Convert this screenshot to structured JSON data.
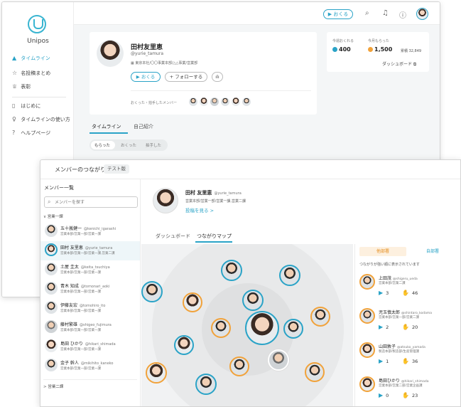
{
  "colors": {
    "accent": "#2aa3c7",
    "orange": "#f1a23a"
  },
  "back": {
    "brand": "Unipos",
    "nav": [
      {
        "icon": "home-icon",
        "glyph": "▲",
        "label": "タイムライン"
      },
      {
        "icon": "star-icon",
        "glyph": "☆",
        "label": "名投稿まとめ"
      },
      {
        "icon": "trophy-icon",
        "glyph": "♕",
        "label": "表彰"
      },
      {
        "icon": "doc-icon",
        "glyph": "▯",
        "label": "はじめに"
      },
      {
        "icon": "bulb-icon",
        "glyph": "♀",
        "label": "タイムラインの使い方"
      },
      {
        "icon": "help-icon",
        "glyph": "?",
        "label": "ヘルプページ"
      }
    ],
    "topbar": {
      "send_label": "▶ おくる"
    },
    "profile": {
      "name": "田村友里恵",
      "handle": "@yurie_tamura",
      "dept": "東京本社/〇〇事業本部/△△事業/営業部",
      "send_btn": "▶ おくる",
      "follow_btn": "+ フォローする",
      "sent_members_label": "おくった・拍手したメンバー"
    },
    "stats": {
      "sent_label": "今週おくれる",
      "sent_value": "400",
      "received_label": "今月もらった",
      "received_value": "1,500",
      "total_label": "累積 32,849",
      "dashboard_label": "ダッシュボード ⧉"
    },
    "tabs": [
      "タイムライン",
      "自己紹介"
    ],
    "segments": [
      "もらった",
      "おくった",
      "拍手した"
    ]
  },
  "front": {
    "title": "メンバーのつながり",
    "badge": "テスト版",
    "members_title": "メンバー一覧",
    "search_placeholder": "メンバーを探す",
    "group1": "∨ 営業一課",
    "group2": "> 営業二課",
    "members": [
      {
        "name": "五十嵐健一",
        "handle": "@kenichi_igarashi",
        "dept": "営業本部/営業一部/営業一課"
      },
      {
        "name": "田村 友里恵",
        "handle": "@yurie_tamura",
        "dept": "営業本部/営業一部/営業一課,営業二課"
      },
      {
        "name": "土屋 圭太",
        "handle": "@keita_tsuchiya",
        "dept": "営業本部/営業一部/営業一課"
      },
      {
        "name": "青木 知成",
        "handle": "@tomonari_aoki",
        "dept": "営業本部/営業一部/営業一課"
      },
      {
        "name": "伊藤友宏",
        "handle": "@tomohiro_ito",
        "dept": "営業本部/営業一部/営業一課"
      },
      {
        "name": "藤村繁雄",
        "handle": "@shigeo_fujimura",
        "dept": "営業本部/営業一部/営業一課"
      },
      {
        "name": "島田 ひかり",
        "handle": "@hikari_shimada",
        "dept": "営業本部/営業一部/営業一課"
      },
      {
        "name": "金子 幹人",
        "handle": "@mikihito_kaneko",
        "dept": "営業本部/営業一部/営業一課"
      }
    ],
    "user": {
      "name": "田村 友里恵",
      "handle": "@yurie_tamura",
      "dept": "営業本部/営業一部/営業一課,営業二課",
      "posts_link": "投稿を見る >"
    },
    "tabs": [
      "ダッシュボード",
      "つながりマップ"
    ],
    "panel": {
      "tab_other": "他部署",
      "tab_own": "自部署",
      "note": "つながりが強い順に表示されています",
      "items": [
        {
          "name": "上田茂",
          "handle": "@shigeru_ueda",
          "dept": "営業本部/営業二課",
          "sent": "3",
          "received": "46"
        },
        {
          "name": "児玉慎太郎",
          "handle": "@shintaro_kodama",
          "dept": "営業本部/営業一部/営業二課",
          "sent": "2",
          "received": "20"
        },
        {
          "name": "山田敦子",
          "handle": "@atsuko_yamada",
          "dept": "製造本部/製造部/生産管理課",
          "sent": "1",
          "received": "36"
        },
        {
          "name": "島田ひかり",
          "handle": "@hikari_shimada",
          "dept": "営業本部/営業二部/営業企画課",
          "sent": "0",
          "received": "23"
        }
      ]
    }
  }
}
